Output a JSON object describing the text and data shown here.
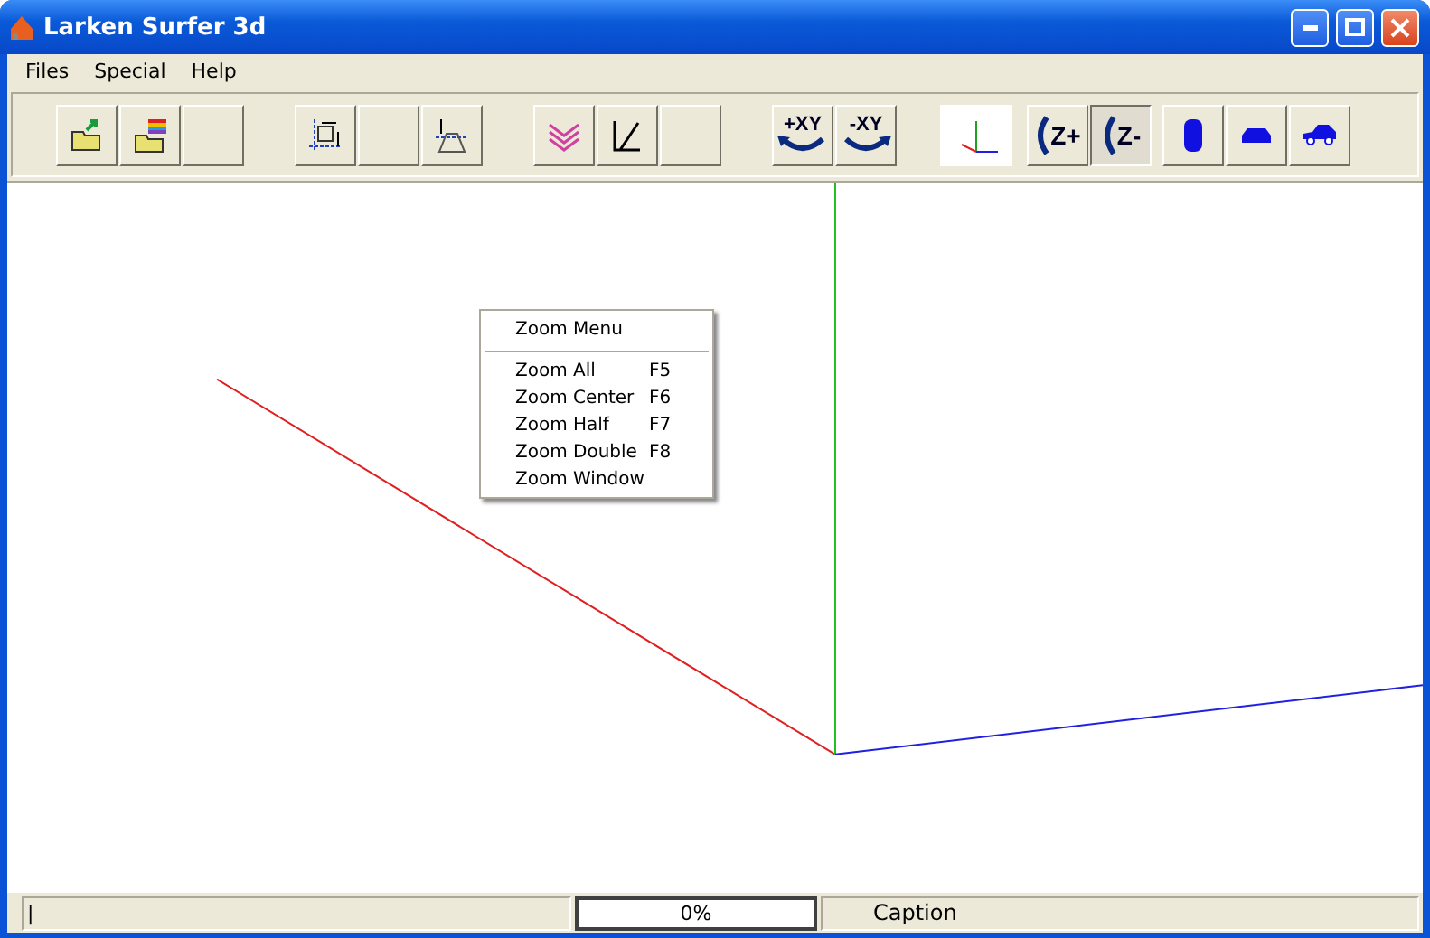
{
  "window": {
    "title": "Larken Surfer 3d"
  },
  "menu": [
    "Files",
    "Special",
    "Help"
  ],
  "toolbar": {
    "groups": [
      [
        {
          "kind": "open-folder",
          "pressed": false
        },
        {
          "kind": "layer-folder",
          "pressed": false
        },
        {
          "kind": "blank",
          "pressed": false
        }
      ],
      [
        {
          "kind": "frame",
          "pressed": false
        },
        {
          "kind": "blank",
          "pressed": false
        },
        {
          "kind": "section",
          "pressed": false
        }
      ],
      [
        {
          "kind": "layers",
          "pressed": false
        },
        {
          "kind": "angle",
          "pressed": false
        },
        {
          "kind": "blank",
          "pressed": false
        }
      ],
      [
        {
          "kind": "rotate-left",
          "label": "+XY",
          "pressed": false
        },
        {
          "kind": "rotate-right",
          "label": "-XY",
          "pressed": false
        }
      ],
      [
        {
          "kind": "axes"
        }
      ],
      [
        {
          "kind": "rotate-z",
          "label": "Z+",
          "pressed": false
        },
        {
          "kind": "rotate-z",
          "label": "Z-",
          "pressed": true
        }
      ],
      [
        {
          "kind": "car-top",
          "pressed": false
        },
        {
          "kind": "car-front",
          "pressed": false
        },
        {
          "kind": "car-side",
          "pressed": false
        }
      ]
    ]
  },
  "context_menu": {
    "title": "Zoom Menu",
    "items": [
      {
        "label": "Zoom All",
        "shortcut": "F5"
      },
      {
        "label": "Zoom Center",
        "shortcut": "F6"
      },
      {
        "label": "Zoom Half",
        "shortcut": "F7"
      },
      {
        "label": "Zoom Double",
        "shortcut": "F8"
      },
      {
        "label": "Zoom Window"
      }
    ]
  },
  "status_bar": {
    "text": "|",
    "progress": {
      "label": "0%",
      "level": 0
    },
    "caption": "Caption"
  }
}
